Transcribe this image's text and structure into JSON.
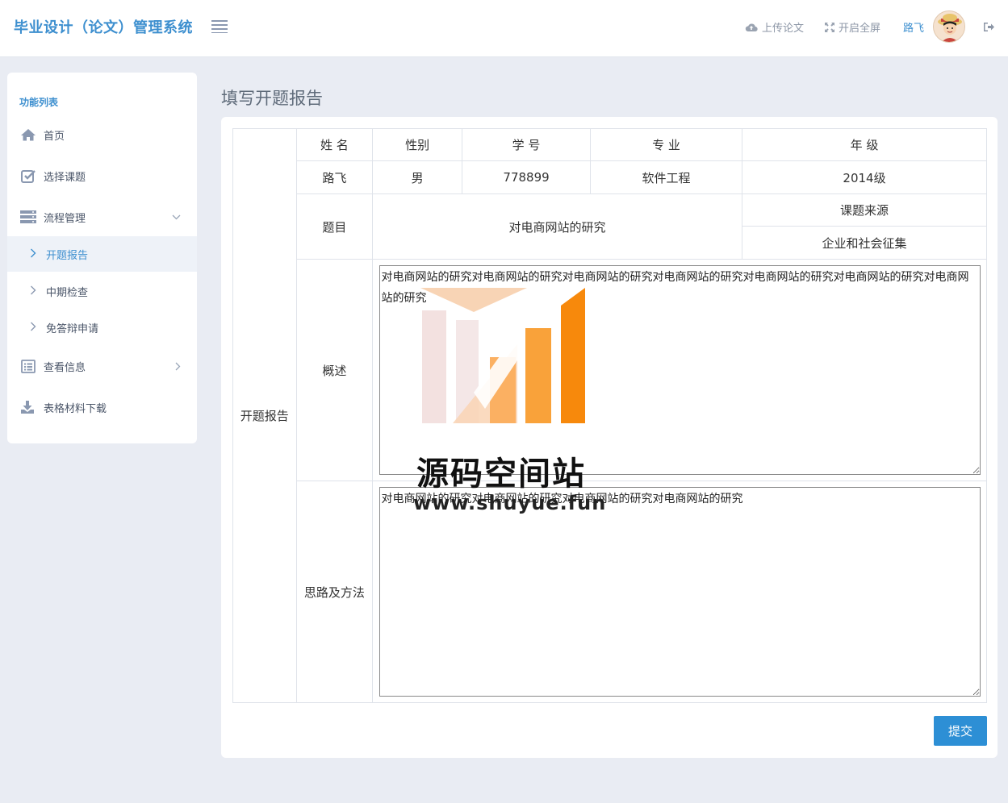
{
  "header": {
    "brand": "毕业设计（论文）管理系统",
    "upload_label": "上传论文",
    "fullscreen_label": "开启全屏",
    "user_name": "路飞"
  },
  "sidebar": {
    "title": "功能列表",
    "items": [
      {
        "label": "首页",
        "icon": "home-icon"
      },
      {
        "label": "选择课题",
        "icon": "checkbox-icon"
      },
      {
        "label": "流程管理",
        "icon": "server-icon"
      },
      {
        "label": "查看信息",
        "icon": "list-icon"
      },
      {
        "label": "表格材料下载",
        "icon": "download-icon"
      }
    ],
    "sub_items": [
      {
        "label": "开题报告"
      },
      {
        "label": "中期检查"
      },
      {
        "label": "免答辩申请"
      }
    ]
  },
  "page": {
    "title": "填写开题报告"
  },
  "form": {
    "side_label": "开题报告",
    "headers": [
      "姓 名",
      "性别",
      "学 号",
      "专 业",
      "年 级"
    ],
    "values": [
      "路飞",
      "男",
      "778899",
      "软件工程",
      "2014级"
    ],
    "topic_label": "题目",
    "topic_value": "对电商网站的研究",
    "source_label": "课题来源",
    "source_value": "企业和社会征集",
    "summary_label": "概述",
    "summary_text": "对电商网站的研究对电商网站的研究对电商网站的研究对电商网站的研究对电商网站的研究对电商网站的研究对电商网站的研究",
    "method_label": "思路及方法",
    "method_text": "对电商网站的研究对电商网站的研究对电商网站的研究对电商网站的研究",
    "submit_label": "提交"
  },
  "watermark": {
    "title": "源码空间站",
    "url": "www.shuyue.fun"
  },
  "colors": {
    "accent": "#3d8fcf",
    "submit": "#2d8fd5",
    "background": "#e9ecf3",
    "watermark_orange": "#f7890c"
  }
}
